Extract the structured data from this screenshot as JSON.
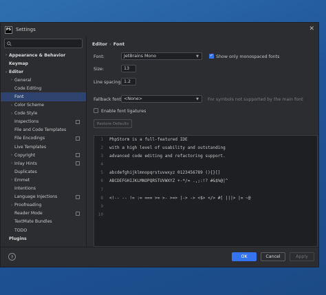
{
  "window": {
    "title": "Settings",
    "app_badge": "PS"
  },
  "search": {
    "placeholder": ""
  },
  "sidebar": {
    "items": [
      {
        "label": "Appearance & Behavior",
        "arrow": "›",
        "bold": true
      },
      {
        "label": "Keymap",
        "arrow": "",
        "bold": true
      },
      {
        "label": "Editor",
        "arrow": "⌄",
        "bold": true
      },
      {
        "label": "General",
        "arrow": "›",
        "indent": 1
      },
      {
        "label": "Code Editing",
        "arrow": "",
        "indent": 1
      },
      {
        "label": "Font",
        "arrow": "",
        "indent": 1,
        "selected": true
      },
      {
        "label": "Color Scheme",
        "arrow": "›",
        "indent": 1
      },
      {
        "label": "Code Style",
        "arrow": "›",
        "indent": 1
      },
      {
        "label": "Inspections",
        "arrow": "",
        "indent": 1,
        "project": true
      },
      {
        "label": "File and Code Templates",
        "arrow": "",
        "indent": 1
      },
      {
        "label": "File Encodings",
        "arrow": "",
        "indent": 1,
        "project": true
      },
      {
        "label": "Live Templates",
        "arrow": "",
        "indent": 1
      },
      {
        "label": "Copyright",
        "arrow": "›",
        "indent": 1,
        "project": true
      },
      {
        "label": "Inlay Hints",
        "arrow": "›",
        "indent": 1,
        "project": true
      },
      {
        "label": "Duplicates",
        "arrow": "",
        "indent": 1
      },
      {
        "label": "Emmet",
        "arrow": "›",
        "indent": 1
      },
      {
        "label": "Intentions",
        "arrow": "",
        "indent": 1
      },
      {
        "label": "Language Injections",
        "arrow": "",
        "indent": 1,
        "project": true
      },
      {
        "label": "Proofreading",
        "arrow": "›",
        "indent": 1
      },
      {
        "label": "Reader Mode",
        "arrow": "",
        "indent": 1,
        "project": true
      },
      {
        "label": "TextMate Bundles",
        "arrow": "",
        "indent": 1
      },
      {
        "label": "TODO",
        "arrow": "",
        "indent": 1
      },
      {
        "label": "Plugins",
        "arrow": "",
        "bold": true
      }
    ]
  },
  "breadcrumb": {
    "parent": "Editor",
    "separator": "›",
    "current": "Font"
  },
  "font": {
    "label": "Font:",
    "value": "JetBrains Mono",
    "mono_only_label": "Show only monospaced fonts",
    "size_label": "Size:",
    "size_value": "13",
    "spacing_label": "Line spacing:",
    "spacing_value": "1.2",
    "fallback_label": "Fallback font:",
    "fallback_value": "<None>",
    "fallback_hint": "For symbols not supported by the main font",
    "ligatures_label": "Enable font ligatures",
    "restore_label": "Restore Defaults"
  },
  "preview": {
    "line_numbers": [
      "1",
      "2",
      "3",
      "4",
      "5",
      "6",
      "7",
      "8",
      "9",
      "10"
    ],
    "lines": [
      "PhpStorm is a full-featured IDE",
      "with a high level of usability and outstanding",
      "advanced code editing and refactoring support.",
      "",
      "abcdefghijklmnopqrstuvwxyz 0123456789 (){}[]",
      "ABCDEFGHIJKLMNOPQRSTUVWXYZ +-*/= .,;:!? #&$%@|^",
      "",
      "<!-- -- != := === >= >- >=> |-> -> <$> </> #[ |||> |= ~@",
      "",
      ""
    ]
  },
  "footer": {
    "help": "?",
    "ok": "OK",
    "cancel": "Cancel",
    "apply": "Apply"
  },
  "colors": {
    "accent": "#3574f0",
    "selection": "#2e436e"
  }
}
